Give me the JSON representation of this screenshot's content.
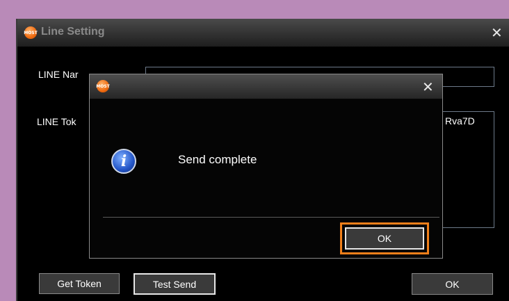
{
  "window": {
    "title": "Line Setting",
    "close_glyph": "✕",
    "icon": "app-logo-icon",
    "icon_text": "MOST"
  },
  "form": {
    "line_name_label": "LINE Nar",
    "line_name_value": "",
    "line_token_label": "LINE Tok",
    "line_token_visible": "Rva7D"
  },
  "buttons": {
    "get_token": "Get Token",
    "test_send": "Test Send",
    "ok": "OK"
  },
  "dialog": {
    "close_glyph": "✕",
    "icon": "info-icon",
    "info_glyph": "i",
    "message": "Send complete",
    "ok": "OK"
  },
  "colors": {
    "highlight": "#f07f1a",
    "background": "#b98ab8"
  }
}
